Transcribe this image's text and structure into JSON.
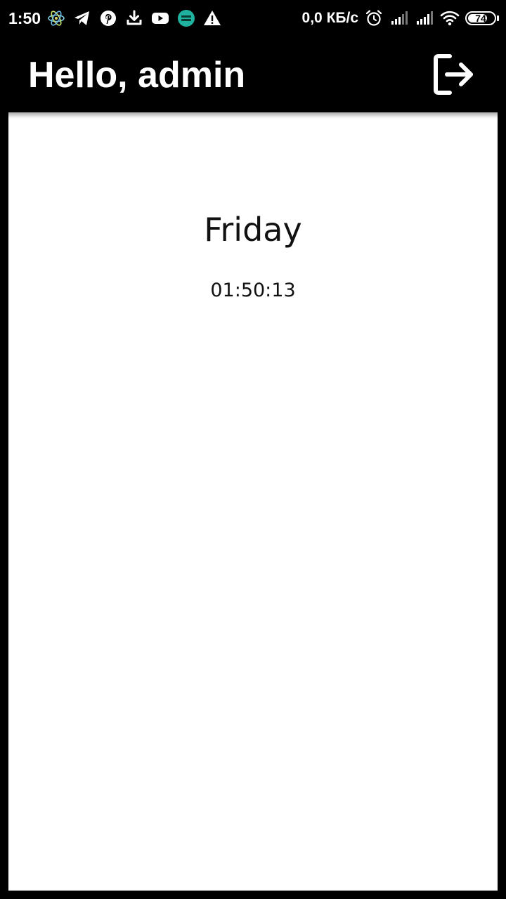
{
  "status_bar": {
    "time": "1:50",
    "net_speed": "0,0 КБ/с",
    "battery_level": "74",
    "battery_fraction": 0.74,
    "notification_icons": [
      "atom-icon",
      "telegram-icon",
      "pinterest-icon",
      "download-icon",
      "youtube-icon",
      "anybooks-icon",
      "warning-icon"
    ],
    "system_icons": [
      "alarm-icon",
      "signal-icon",
      "signal-icon",
      "wifi-icon",
      "battery-icon"
    ]
  },
  "app_bar": {
    "title": "Hello, admin",
    "logout_icon": "logout-icon"
  },
  "main": {
    "day": "Friday",
    "time": "01:50:13"
  },
  "colors": {
    "app_bar_bg": "#000000",
    "content_bg": "#ffffff",
    "text": "#111111"
  }
}
